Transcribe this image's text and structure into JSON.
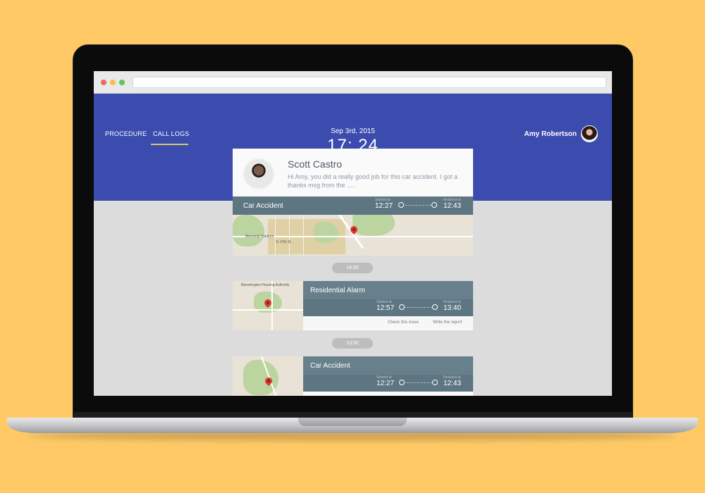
{
  "header": {
    "nav": [
      {
        "label": "PROCEDURE"
      },
      {
        "label": "CALL LOGS"
      }
    ],
    "date": "Sep 3rd, 2015",
    "time": "17: 24",
    "user": {
      "name": "Amy Robertson"
    }
  },
  "message": {
    "sender": "Scott Castro",
    "text": "Hi Amy, you did a really good job for this car accident. I got a thanks msg from the ....."
  },
  "events": [
    {
      "title": "Car Accident",
      "started_label": "Started at",
      "started": "12:27",
      "finished_label": "Finished at",
      "finished": "12:43",
      "map_labels": [
        "Memorial Stadium",
        "E 17th St"
      ]
    },
    {
      "title": "Residential Alarm",
      "started_label": "Started at",
      "started": "12:57",
      "finished_label": "Finished at",
      "finished": "13:40",
      "actions": [
        "Check this issue",
        "Write the report"
      ],
      "map_labels": [
        "Bloomington Housing Authority",
        "Bloomington"
      ]
    },
    {
      "title": "Car Accident",
      "started_label": "Started at",
      "started": "12:27",
      "finished_label": "Finished at",
      "finished": "12:43"
    }
  ],
  "dividers": [
    "14:00",
    "13:00"
  ],
  "colors": {
    "header_bg": "#3B4BAE",
    "event_bar": "#5E7682",
    "tab_underline": "#d8c768",
    "page_bg": "#FFCA66"
  }
}
